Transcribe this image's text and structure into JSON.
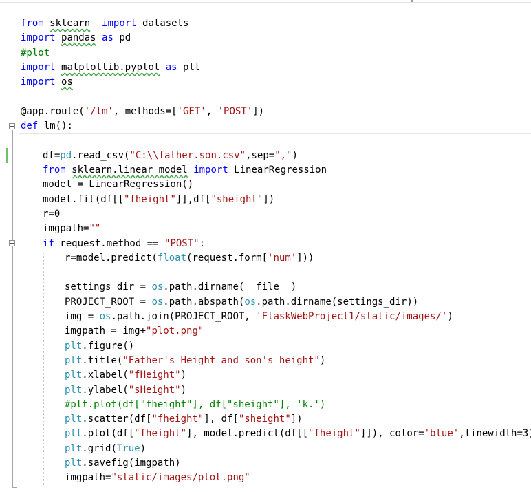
{
  "editor": {
    "language": "python",
    "lines": [
      {
        "indent": 0,
        "tokens": [
          [
            "kw",
            "from "
          ],
          [
            "sq",
            "sklearn"
          ],
          [
            "",
            "  "
          ],
          [
            "kw",
            "import"
          ],
          [
            "",
            " datasets"
          ]
        ]
      },
      {
        "indent": 0,
        "tokens": [
          [
            "kw",
            "import "
          ],
          [
            "sq",
            "pandas"
          ],
          [
            "",
            " "
          ],
          [
            "kw",
            "as"
          ],
          [
            "",
            " pd"
          ]
        ]
      },
      {
        "indent": 0,
        "tokens": [
          [
            "cm",
            "#plot"
          ]
        ]
      },
      {
        "indent": 0,
        "tokens": [
          [
            "kw",
            "import "
          ],
          [
            "sq",
            "matplotlib.pyplot"
          ],
          [
            "",
            " "
          ],
          [
            "kw",
            "as"
          ],
          [
            "",
            " plt"
          ]
        ]
      },
      {
        "indent": 0,
        "tokens": [
          [
            "kw",
            "import "
          ],
          [
            "sq",
            "os"
          ]
        ]
      },
      {
        "indent": 0,
        "tokens": []
      },
      {
        "indent": 0,
        "tokens": [
          [
            "",
            "@app.route("
          ],
          [
            "str",
            "'/lm'"
          ],
          [
            "",
            ", methods=["
          ],
          [
            "str",
            "'GET'"
          ],
          [
            "",
            ", "
          ],
          [
            "str",
            "'POST'"
          ],
          [
            "",
            "])"
          ]
        ]
      },
      {
        "indent": 0,
        "tokens": [
          [
            "kw",
            "def"
          ],
          [
            "",
            " lm():"
          ]
        ]
      },
      {
        "indent": 0,
        "tokens": []
      },
      {
        "indent": 1,
        "tokens": [
          [
            "",
            "df="
          ],
          [
            "fn",
            "pd"
          ],
          [
            "",
            ".read_csv("
          ],
          [
            "str",
            "\"C:\\\\father.son.csv\""
          ],
          [
            "",
            ",sep="
          ],
          [
            "str",
            "\",\""
          ],
          [
            "",
            ")"
          ]
        ]
      },
      {
        "indent": 1,
        "tokens": [
          [
            "kw",
            "from "
          ],
          [
            "sq",
            "sklearn.linear_model"
          ],
          [
            "",
            " "
          ],
          [
            "kw",
            "import"
          ],
          [
            "",
            " LinearRegression"
          ]
        ]
      },
      {
        "indent": 1,
        "tokens": [
          [
            "",
            "model = LinearRegression()"
          ]
        ]
      },
      {
        "indent": 1,
        "tokens": [
          [
            "",
            "model.fit(df[["
          ],
          [
            "str",
            "\"fheight\""
          ],
          [
            "",
            "]],df["
          ],
          [
            "str",
            "\"sheight\""
          ],
          [
            "",
            "])"
          ]
        ]
      },
      {
        "indent": 1,
        "tokens": [
          [
            "",
            "r=0"
          ]
        ]
      },
      {
        "indent": 1,
        "tokens": [
          [
            "",
            "imgpath="
          ],
          [
            "str",
            "\"\""
          ]
        ]
      },
      {
        "indent": 1,
        "tokens": [
          [
            "kw",
            "if"
          ],
          [
            "",
            " request.method == "
          ],
          [
            "str",
            "\"POST\""
          ],
          [
            "",
            ":"
          ]
        ]
      },
      {
        "indent": 2,
        "tokens": [
          [
            "",
            "r=model.predict("
          ],
          [
            "fn",
            "float"
          ],
          [
            "",
            "(request.form["
          ],
          [
            "str",
            "'num'"
          ],
          [
            "",
            "]))"
          ]
        ]
      },
      {
        "indent": 0,
        "tokens": []
      },
      {
        "indent": 2,
        "tokens": [
          [
            "",
            "settings_dir = "
          ],
          [
            "fn",
            "os"
          ],
          [
            "",
            ".path.dirname(__file__)"
          ]
        ]
      },
      {
        "indent": 2,
        "tokens": [
          [
            "",
            "PROJECT_ROOT = "
          ],
          [
            "fn",
            "os"
          ],
          [
            "",
            ".path.abspath("
          ],
          [
            "fn",
            "os"
          ],
          [
            "",
            ".path.dirname(settings_dir))"
          ]
        ]
      },
      {
        "indent": 2,
        "tokens": [
          [
            "",
            "img = "
          ],
          [
            "fn",
            "os"
          ],
          [
            "",
            ".path.join(PROJECT_ROOT, "
          ],
          [
            "str",
            "'FlaskWebProject1/static/images/'"
          ],
          [
            "",
            ")"
          ]
        ]
      },
      {
        "indent": 2,
        "tokens": [
          [
            "",
            "imgpath = img+"
          ],
          [
            "str",
            "\"plot.png\""
          ]
        ]
      },
      {
        "indent": 2,
        "tokens": [
          [
            "fn",
            "plt"
          ],
          [
            "",
            ".figure()"
          ]
        ]
      },
      {
        "indent": 2,
        "tokens": [
          [
            "fn",
            "plt"
          ],
          [
            "",
            ".title("
          ],
          [
            "str",
            "\"Father's Height and son's height\""
          ],
          [
            "",
            ")"
          ]
        ]
      },
      {
        "indent": 2,
        "tokens": [
          [
            "fn",
            "plt"
          ],
          [
            "",
            ".xlabel("
          ],
          [
            "str",
            "\"fHeight\""
          ],
          [
            "",
            ")"
          ]
        ]
      },
      {
        "indent": 2,
        "tokens": [
          [
            "fn",
            "plt"
          ],
          [
            "",
            ".ylabel("
          ],
          [
            "str",
            "\"sHeight\""
          ],
          [
            "",
            ")"
          ]
        ]
      },
      {
        "indent": 2,
        "tokens": [
          [
            "cm",
            "#plt.plot(df[\"fheight\"], df[\"sheight\"], 'k.')"
          ]
        ]
      },
      {
        "indent": 2,
        "tokens": [
          [
            "fn",
            "plt"
          ],
          [
            "",
            ".scatter(df["
          ],
          [
            "str",
            "\"fheight\""
          ],
          [
            "",
            "], df["
          ],
          [
            "str",
            "\"sheight\""
          ],
          [
            "",
            "])"
          ]
        ]
      },
      {
        "indent": 2,
        "tokens": [
          [
            "fn",
            "plt"
          ],
          [
            "",
            ".plot(df["
          ],
          [
            "str",
            "\"fheight\""
          ],
          [
            "",
            "], model.predict(df[["
          ],
          [
            "str",
            "\"fheight\""
          ],
          [
            "",
            "]]), color="
          ],
          [
            "str",
            "'blue'"
          ],
          [
            "",
            ",linewidth=3)"
          ]
        ]
      },
      {
        "indent": 2,
        "tokens": [
          [
            "fn",
            "plt"
          ],
          [
            "",
            ".grid("
          ],
          [
            "fn",
            "True"
          ],
          [
            "",
            ")"
          ]
        ]
      },
      {
        "indent": 2,
        "tokens": [
          [
            "fn",
            "plt"
          ],
          [
            "",
            ".savefig(imgpath)"
          ]
        ]
      },
      {
        "indent": 2,
        "tokens": [
          [
            "",
            "imgpath="
          ],
          [
            "str",
            "\"static/images/plot.png\""
          ]
        ]
      }
    ]
  }
}
